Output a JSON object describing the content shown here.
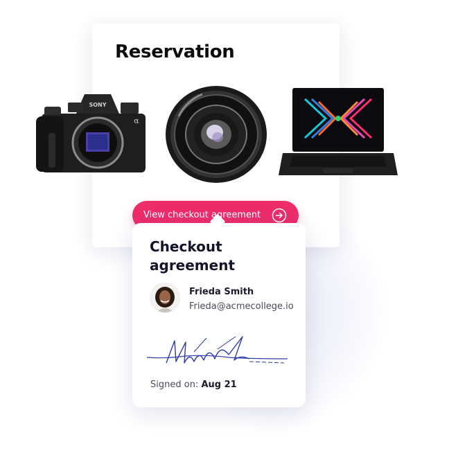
{
  "reservation": {
    "title": "Reservation",
    "products": [
      {
        "icon": "camera-icon",
        "brand": "SONY",
        "model": "α"
      },
      {
        "icon": "lens-icon"
      },
      {
        "icon": "laptop-icon"
      }
    ]
  },
  "checkout_button": {
    "label": "View checkout agreement",
    "icon": "arrow-right-circle-icon",
    "color": "#ee2c6a"
  },
  "agreement": {
    "title": "Checkout agreement",
    "user": {
      "name": "Frieda Smith",
      "email": "Frieda@acmecollege.io"
    },
    "signed_prefix": "Signed on:",
    "signed_date": "Aug 21",
    "signature_color": "#2d3aa8"
  }
}
